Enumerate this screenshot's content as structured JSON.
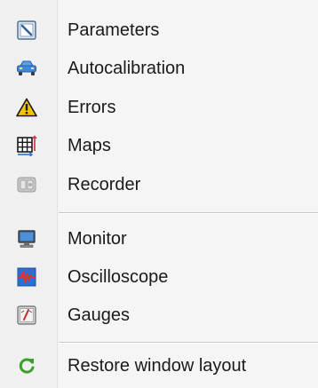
{
  "menu": {
    "items": [
      {
        "label": "Parameters",
        "icon": "parameters-icon"
      },
      {
        "label": "Autocalibration",
        "icon": "car-icon"
      },
      {
        "label": "Errors",
        "icon": "warning-icon"
      },
      {
        "label": "Maps",
        "icon": "grid-map-icon"
      },
      {
        "label": "Recorder",
        "icon": "recorder-icon"
      },
      {
        "label": "Monitor",
        "icon": "monitor-icon"
      },
      {
        "label": "Oscilloscope",
        "icon": "oscilloscope-icon"
      },
      {
        "label": "Gauges",
        "icon": "gauge-icon"
      },
      {
        "label": "Restore window layout",
        "icon": "refresh-icon"
      }
    ]
  },
  "colors": {
    "warning": "#f2c500",
    "refresh": "#3aa02a",
    "monitor": "#2f6fb5",
    "oscilloscope_bg": "#2a6fd6",
    "oscilloscope_wave": "#e03030",
    "car": "#3d8ad8"
  }
}
